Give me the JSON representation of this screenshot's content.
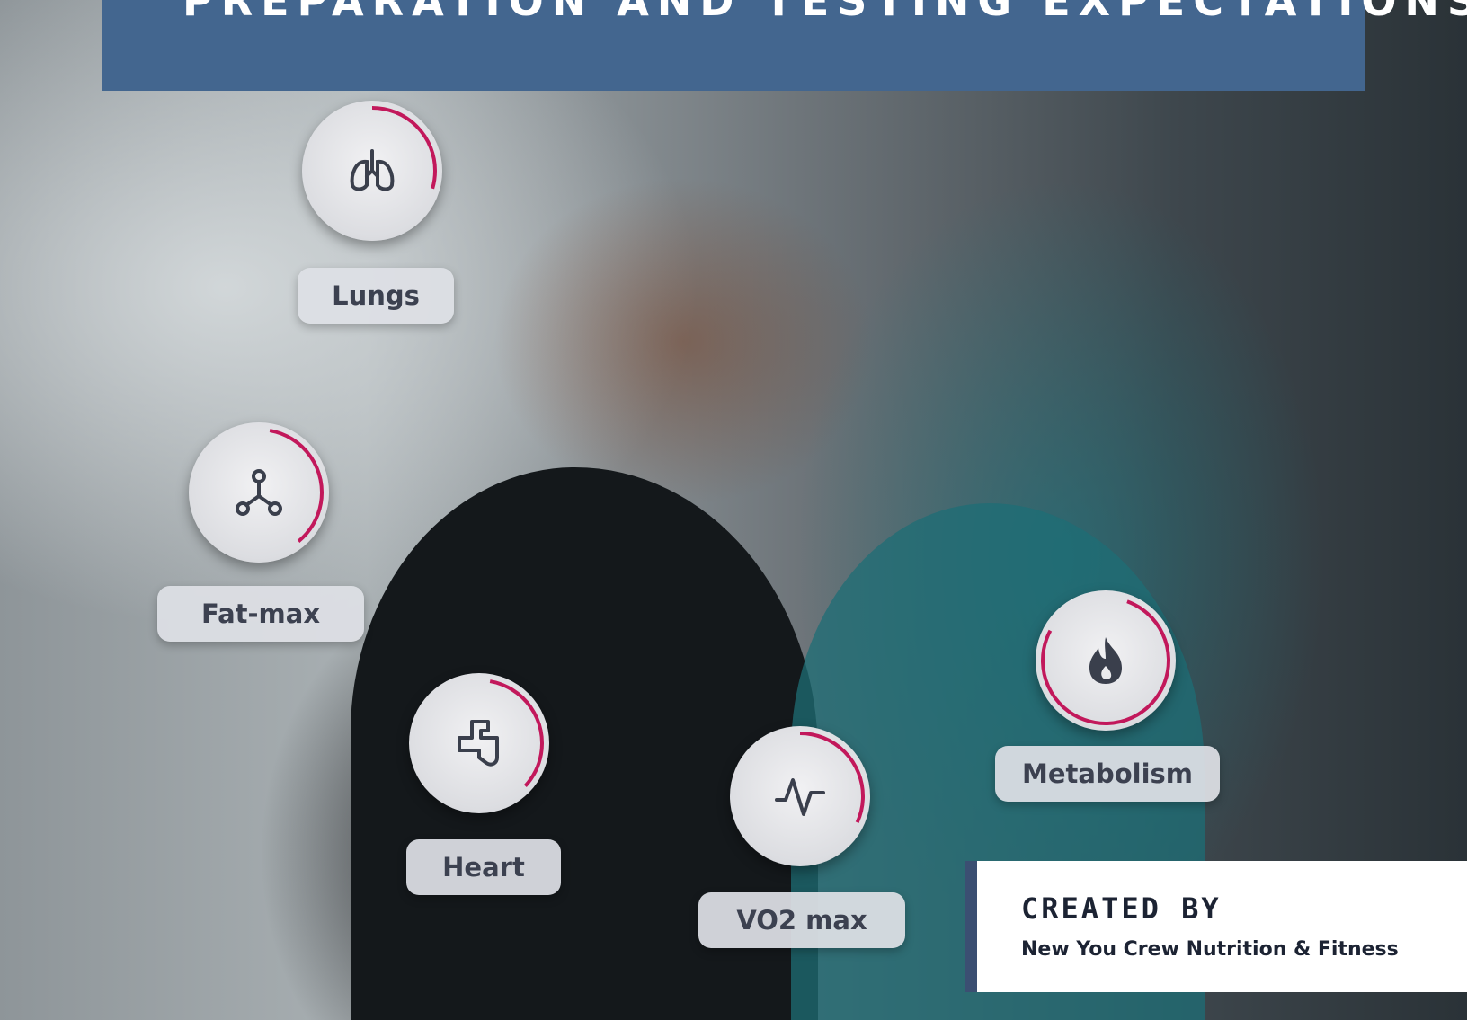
{
  "banner": {
    "title": "PREPARATION AND TESTING EXPECTATIONS"
  },
  "metrics": [
    {
      "label": "Lungs",
      "icon": "lungs-icon"
    },
    {
      "label": "Fat-max",
      "icon": "molecule-icon"
    },
    {
      "label": "Heart",
      "icon": "heart-icon"
    },
    {
      "label": "VO2 max",
      "icon": "pulse-icon"
    },
    {
      "label": "Metabolism",
      "icon": "flame-icon"
    }
  ],
  "credit": {
    "label": "CREATED BY",
    "name": "New You Crew Nutrition & Fitness"
  },
  "colors": {
    "banner": "#43668f",
    "ring_accent": "#c2185b",
    "icon": "#3a3f4c",
    "credit_bar": "#3b4f72"
  }
}
